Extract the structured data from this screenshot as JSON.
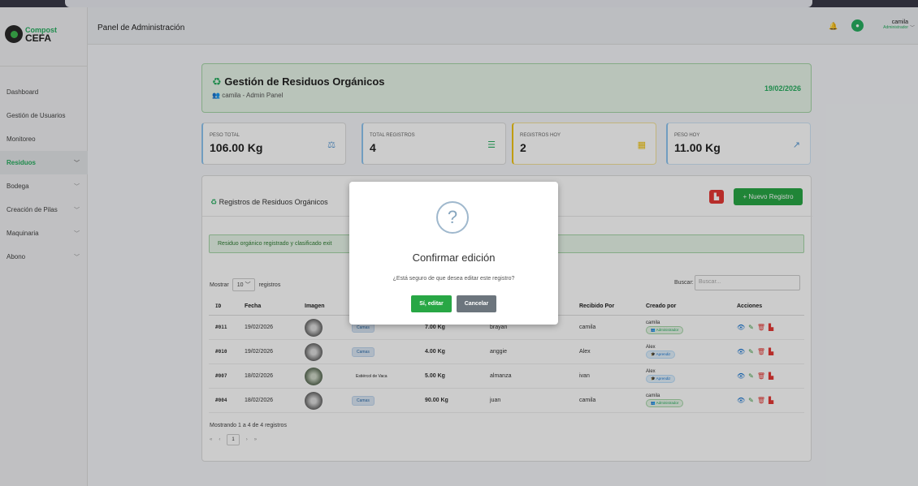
{
  "app": {
    "logo_line1": "Compost",
    "logo_line2": "CEFA"
  },
  "header": {
    "title": "Panel de Administración",
    "user_name": "camila",
    "user_role": "Administrador"
  },
  "sidebar": {
    "items": [
      {
        "label": "Dashboard",
        "has_chevron": false
      },
      {
        "label": "Gestión de Usuarios",
        "has_chevron": false
      },
      {
        "label": "Monitoreo",
        "has_chevron": false
      },
      {
        "label": "Residuos",
        "has_chevron": true
      },
      {
        "label": "Bodega",
        "has_chevron": true
      },
      {
        "label": "Creación de Pilas",
        "has_chevron": true
      },
      {
        "label": "Maquinaria",
        "has_chevron": true
      },
      {
        "label": "Abono",
        "has_chevron": true
      }
    ]
  },
  "banner": {
    "title": "Gestión de Residuos Orgánicos",
    "subtitle": "camila - Admin Panel",
    "date": "19/02/2026"
  },
  "stats": [
    {
      "label": "PESO TOTAL",
      "value": "106.00 Kg",
      "icon": "weight-icon",
      "color": "#5b9bd5"
    },
    {
      "label": "TOTAL REGISTROS",
      "value": "4",
      "icon": "list-icon",
      "color": "#27ae60"
    },
    {
      "label": "REGISTROS HOY",
      "value": "2",
      "icon": "calendar-icon",
      "color": "#f1c40f"
    },
    {
      "label": "PESO HOY",
      "value": "11.00 Kg",
      "icon": "chart-line-icon",
      "color": "#5b9bd5"
    }
  ],
  "panel": {
    "title": "Registros de Residuos Orgánicos",
    "new_button": "+ Nuevo Registro",
    "alert": "Residuo orgánico registrado y clasificado exit",
    "length_prefix": "Mostrar",
    "length_value": "10",
    "length_suffix": "registros",
    "search_label": "Buscar:",
    "search_placeholder": "Buscar...",
    "columns": [
      "ID",
      "Fecha",
      "Imagen",
      "Recibido Por",
      "Creado por",
      "Acciones"
    ],
    "rows": [
      {
        "id": "#011",
        "fecha": "19/02/2026",
        "tipo": "Camas",
        "tipo_plain": false,
        "peso": "7.00 Kg",
        "entregado": "brayan",
        "recibido": "camila",
        "creado": "camila",
        "rol": "Administrador",
        "rol_color": "green"
      },
      {
        "id": "#010",
        "fecha": "19/02/2026",
        "tipo": "Camas",
        "tipo_plain": false,
        "peso": "4.00 Kg",
        "entregado": "anggie",
        "recibido": "Alex",
        "creado": "Alex",
        "rol": "Aprendiz",
        "rol_color": "blue"
      },
      {
        "id": "#007",
        "fecha": "18/02/2026",
        "tipo": "Estiércol de Vaca",
        "tipo_plain": true,
        "peso": "5.00 Kg",
        "entregado": "almanza",
        "recibido": "ivan",
        "creado": "Alex",
        "rol": "Aprendiz",
        "rol_color": "blue"
      },
      {
        "id": "#004",
        "fecha": "18/02/2026",
        "tipo": "Camas",
        "tipo_plain": false,
        "peso": "90.00 Kg",
        "entregado": "juan",
        "recibido": "camila",
        "creado": "camila",
        "rol": "Administrador",
        "rol_color": "green"
      }
    ],
    "info": "Mostrando 1 a 4 de 4 registros",
    "pager": {
      "first": "«",
      "prev": "‹",
      "current": "1",
      "next": "›",
      "last": "»"
    }
  },
  "modal": {
    "icon": "?",
    "title": "Confirmar edición",
    "text": "¿Está seguro de que desea editar este registro?",
    "confirm": "Sí, editar",
    "cancel": "Cancelar"
  }
}
